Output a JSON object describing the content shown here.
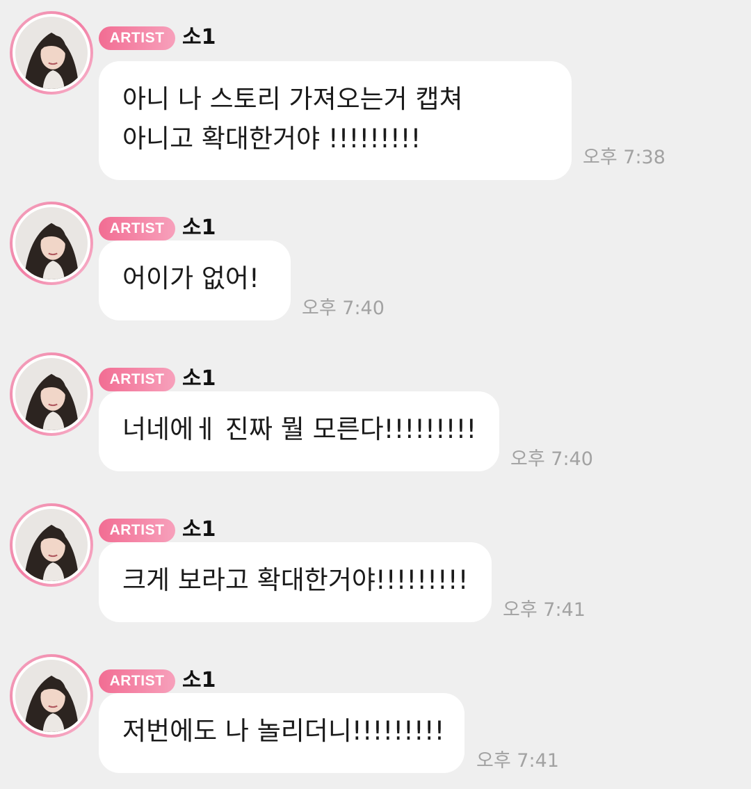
{
  "messages": [
    {
      "badge": "ARTIST",
      "name": "소1",
      "lines": [
        "아니 나 스토리 가져오는거 캡쳐",
        "아니고 확대한거야 !!!!!!!!!"
      ],
      "time": "오후 7:38"
    },
    {
      "badge": "ARTIST",
      "name": "소1",
      "lines": [
        "어이가 없어!"
      ],
      "time": "오후 7:40"
    },
    {
      "badge": "ARTIST",
      "name": "소1",
      "lines": [
        "너네에ㅔ 진짜 뭘 모른다!!!!!!!!!"
      ],
      "time": "오후 7:40"
    },
    {
      "badge": "ARTIST",
      "name": "소1",
      "lines": [
        "크게 보라고 확대한거야!!!!!!!!!"
      ],
      "time": "오후 7:41"
    },
    {
      "badge": "ARTIST",
      "name": "소1",
      "lines": [
        "저번에도 나 놀리더니!!!!!!!!!"
      ],
      "time": "오후 7:41"
    }
  ]
}
